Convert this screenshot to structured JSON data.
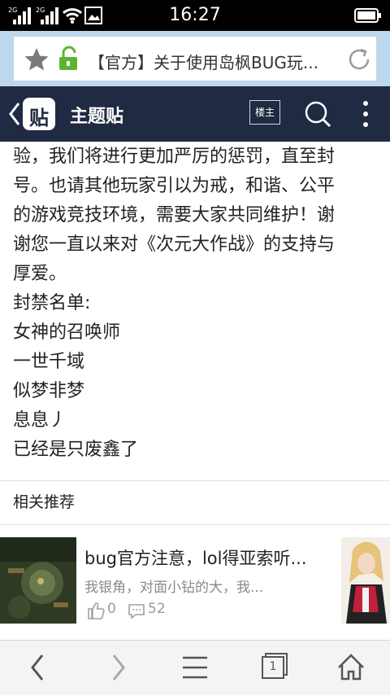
{
  "status_bar": {
    "network_1": "2G",
    "network_2": "2G",
    "time": "16:27"
  },
  "address_bar": {
    "url_text": "【官方】关于使用岛枫BUG玩...",
    "icons": [
      "star-icon",
      "lock-icon",
      "refresh-icon"
    ]
  },
  "nav": {
    "title": "主题贴",
    "logo_char": "贴",
    "louzhu_label": "楼主",
    "icons": [
      "back-icon",
      "search-icon",
      "more-icon"
    ]
  },
  "content": {
    "lines": [
      "验，我们将进行更加严厉的惩罚，直至封",
      "号。也请其他玩家引以为戒，和谐、公平",
      "的游戏竞技环境，需要大家共同维护！谢",
      "谢您一直以来对《次元大作战》的支持与",
      "厚爱。",
      "封禁名单:",
      "女神的召唤师",
      "一世千域",
      "似梦非梦",
      "息息丿",
      "已经是只废鑫了"
    ]
  },
  "related": {
    "title": "相关推荐",
    "items": [
      {
        "title": "bug官方注意，lol得亚索听...",
        "snippet": "我银角，对面小钻的大，我...",
        "likes": "0",
        "comments": "52"
      }
    ]
  },
  "toolbar": {
    "tabs_count": "1",
    "icons": [
      "back-arrow-icon",
      "forward-arrow-icon",
      "menu-icon",
      "tabs-icon",
      "home-icon"
    ]
  },
  "colors": {
    "nav_bg": "#212a43",
    "address_bg": "#bdd8ee",
    "lock_green": "#5cb531",
    "status_bg": "#000000"
  }
}
